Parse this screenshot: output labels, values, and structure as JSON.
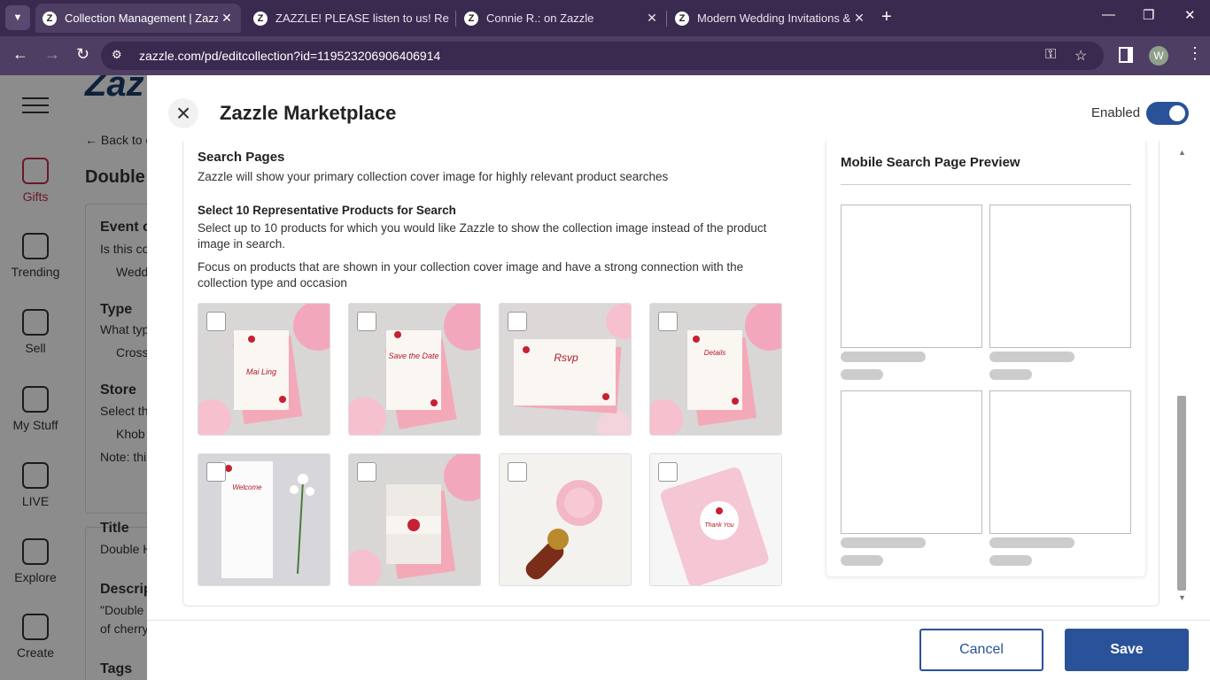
{
  "browser": {
    "tabs": [
      {
        "title": "Collection Management | Zazzle",
        "active": true
      },
      {
        "title": "ZAZZLE! PLEASE listen to us! Re",
        "active": false
      },
      {
        "title": "Connie R.: on Zazzle",
        "active": false
      },
      {
        "title": "Modern Wedding Invitations &",
        "active": false
      }
    ],
    "url": "zazzle.com/pd/editcollection?id=119523206906406914",
    "profile_initial": "W",
    "favicon_letter": "Z"
  },
  "background": {
    "sidebar": [
      {
        "label": "Gifts",
        "icon": "gift-icon"
      },
      {
        "label": "Trending",
        "icon": "trending-icon"
      },
      {
        "label": "Sell",
        "icon": "store-icon"
      },
      {
        "label": "My Stuff",
        "icon": "folder-icon"
      },
      {
        "label": "LIVE",
        "icon": "live-icon"
      },
      {
        "label": "Explore",
        "icon": "bulb-icon"
      },
      {
        "label": "Create",
        "icon": "wand-icon"
      }
    ],
    "logo_fragment": "Zaz",
    "back_link": "Back to c",
    "heading": "Double",
    "fields": {
      "event": "Event o",
      "event_q": "Is this co",
      "event_val": "Wedd",
      "type": "Type",
      "type_q": "What typ",
      "type_val": "Cross",
      "store": "Store",
      "store_q": "Select th",
      "store_val": "Khob",
      "note": "Note: thi",
      "title": "Title",
      "title_val": "Double H",
      "desc": "Descrip",
      "desc_val1": "\"Double",
      "desc_val2": "of cherry",
      "tags": "Tags"
    }
  },
  "modal": {
    "title": "Zazzle Marketplace",
    "enabled_label": "Enabled",
    "enabled": true,
    "search_pages_title": "Search Pages",
    "search_pages_desc": "Zazzle will show your primary collection cover image for highly relevant product searches",
    "select_title": "Select 10 Representative Products for Search",
    "select_desc": "Select up to 10 products for which you would like Zazzle to show the collection image instead of the product image in search.",
    "focus_desc": "Focus on products that are shown in your collection cover image and have a strong connection with the collection type and occasion",
    "products": [
      {
        "kind": "invitation",
        "script": "Mai Ling"
      },
      {
        "kind": "save the date",
        "script": "Save the Date"
      },
      {
        "kind": "rsvp card",
        "script": "Rsvp"
      },
      {
        "kind": "details card",
        "script": "Details"
      },
      {
        "kind": "program",
        "script": "Welcome"
      },
      {
        "kind": "belly band invitation",
        "script": ""
      },
      {
        "kind": "wax seal",
        "script": ""
      },
      {
        "kind": "thank you notebook",
        "script": "Thank You"
      }
    ],
    "preview_title": "Mobile Search Page Preview",
    "cancel_label": "Cancel",
    "save_label": "Save"
  },
  "colors": {
    "accent": "#2a5298",
    "gifts": "#c12e4c",
    "chrome": "#3b2a4f"
  }
}
